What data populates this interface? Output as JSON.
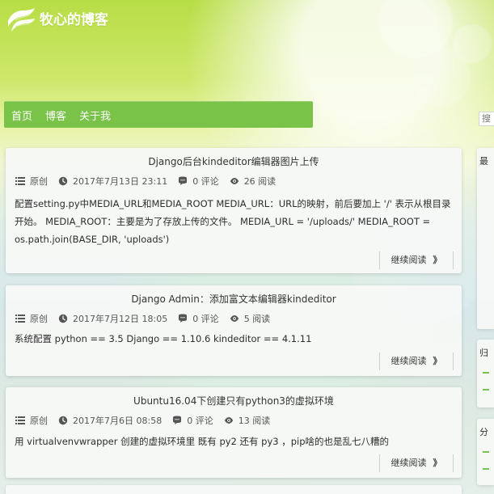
{
  "site": {
    "title": "牧心的博客"
  },
  "nav": {
    "items": [
      {
        "label": "首页"
      },
      {
        "label": "博客"
      },
      {
        "label": "关于我"
      }
    ]
  },
  "search": {
    "placeholder": "搜"
  },
  "posts": [
    {
      "title": "Django后台kindeditor编辑器图片上传",
      "type": "原创",
      "date": "2017年7月13日 23:11",
      "comments": "0 评论",
      "views": "26 阅读",
      "summary": "配置setting.py中MEDIA_URL和MEDIA_ROOT MEDIA_URL：URL的映射，前后要加上 '/'  表示从根目录开始。 MEDIA_ROOT：主要是为了存放上传的文件。 MEDIA_URL = '/uploads/' MEDIA_ROOT = os.path.join(BASE_DIR, 'uploads')",
      "read_more": "继续阅读",
      "read_more_arrow": "》"
    },
    {
      "title": "Django Admin：添加富文本编辑器kindeditor",
      "type": "原创",
      "date": "2017年7月12日 18:05",
      "comments": "0 评论",
      "views": "5 阅读",
      "summary": "系统配置 python == 3.5 Django == 1.10.6 kindeditor == 4.1.11",
      "read_more": "继续阅读",
      "read_more_arrow": "》"
    },
    {
      "title": "Ubuntu16.04下创建只有python3的虚拟环境",
      "type": "原创",
      "date": "2017年7月6日 08:58",
      "comments": "0 评论",
      "views": "13 阅读",
      "summary": "用 virtualvenvwrapper 创建的虚拟环境里 既有 py2 还有 py3 ，pip啥的也是乱七八糟的",
      "read_more": "继续阅读",
      "read_more_arrow": "》"
    }
  ],
  "sidebar": {
    "sections": [
      {
        "title": "最"
      },
      {
        "title": "归"
      },
      {
        "title": "分"
      }
    ]
  },
  "colors": {
    "nav": "#79c349",
    "accent": "#78c04f",
    "title_text": "#ffffff"
  }
}
